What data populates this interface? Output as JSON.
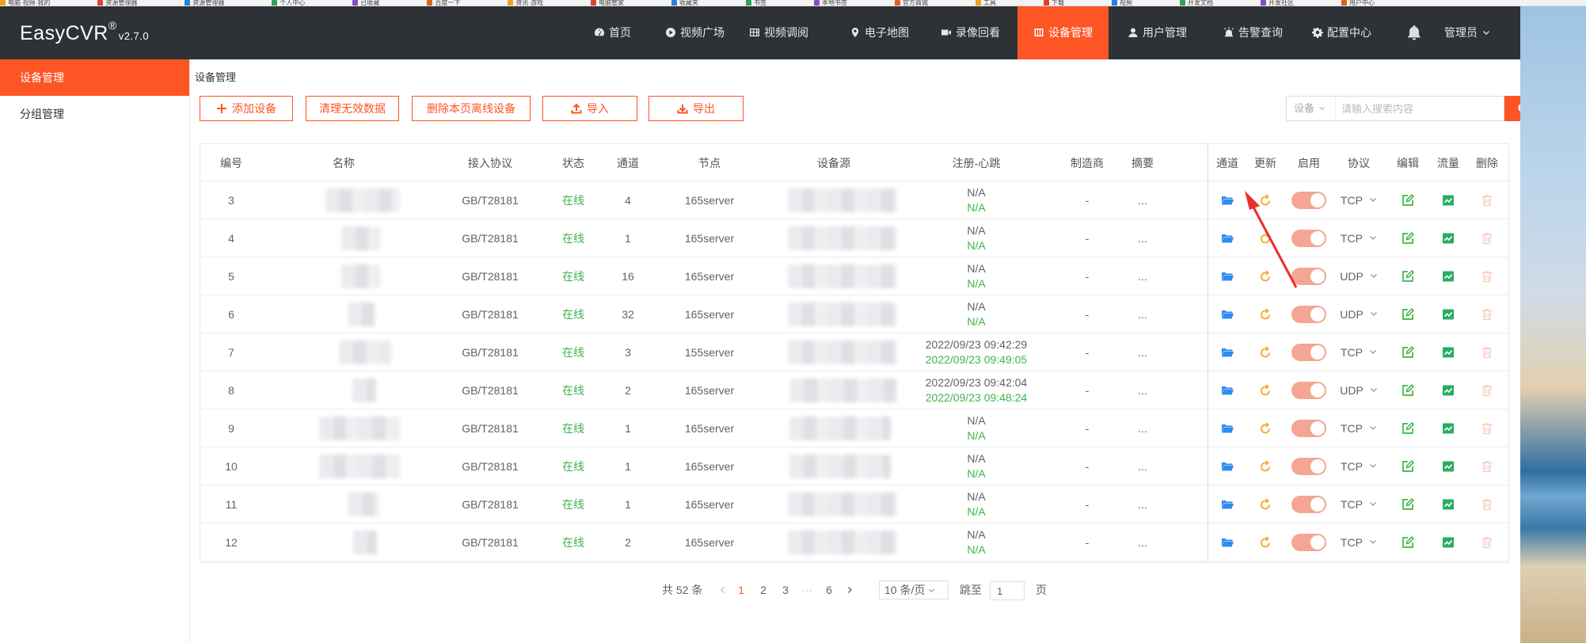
{
  "bookmarks": [
    "电脑·视频·我的",
    "资源管理器",
    "资源管理器",
    "个人中心",
    "已收藏",
    "百度一下",
    "资讯·游戏",
    "电脑管家",
    "收藏夹",
    "书签",
    "本地书签",
    "官方商城",
    "工具",
    "下载",
    "视频",
    "开发文档",
    "开发社区",
    "用户中心"
  ],
  "app": {
    "brand": "EasyCVR",
    "brand_mark": "®",
    "version": "v2.7.0"
  },
  "nav": [
    {
      "label": "首页",
      "icon": "dashboard-icon"
    },
    {
      "label": "视频广场",
      "icon": "play-circle-icon"
    },
    {
      "label": "视频调阅",
      "icon": "grid-icon"
    },
    {
      "label": "电子地图",
      "icon": "map-pin-icon"
    },
    {
      "label": "录像回看",
      "icon": "video-camera-icon"
    },
    {
      "label": "设备管理",
      "icon": "device-icon",
      "active": true
    },
    {
      "label": "用户管理",
      "icon": "user-icon"
    },
    {
      "label": "告警查询",
      "icon": "alarm-icon"
    },
    {
      "label": "配置中心",
      "icon": "gear-icon"
    }
  ],
  "user": {
    "name": "管理员"
  },
  "sidebar": [
    {
      "label": "设备管理",
      "active": true
    },
    {
      "label": "分组管理",
      "active": false
    }
  ],
  "breadcrumb": "设备管理",
  "toolbar": {
    "add": "添加设备",
    "clean": "清理无效数据",
    "delete_offline": "删除本页离线设备",
    "import": "导入",
    "export": "导出"
  },
  "search": {
    "type": "设备",
    "placeholder": "请输入搜索内容"
  },
  "table": {
    "headers": [
      "编号",
      "名称",
      "接入协议",
      "状态",
      "通道",
      "节点",
      "设备源",
      "注册-心跳",
      "制造商",
      "摘要",
      "通道",
      "更新",
      "启用",
      "协议",
      "编辑",
      "流量",
      "删除"
    ],
    "rows": [
      {
        "id": "3",
        "protocol": "GB/T28181",
        "status": "在线",
        "channels": "4",
        "node": "165server",
        "register": "N/A",
        "heartbeat": "N/A",
        "maker": "-",
        "summary": "...",
        "transport": "TCP"
      },
      {
        "id": "4",
        "protocol": "GB/T28181",
        "status": "在线",
        "channels": "1",
        "node": "165server",
        "register": "N/A",
        "heartbeat": "N/A",
        "maker": "-",
        "summary": "...",
        "transport": "TCP"
      },
      {
        "id": "5",
        "protocol": "GB/T28181",
        "status": "在线",
        "channels": "16",
        "node": "165server",
        "register": "N/A",
        "heartbeat": "N/A",
        "maker": "-",
        "summary": "...",
        "transport": "UDP"
      },
      {
        "id": "6",
        "protocol": "GB/T28181",
        "status": "在线",
        "channels": "32",
        "node": "165server",
        "register": "N/A",
        "heartbeat": "N/A",
        "maker": "-",
        "summary": "...",
        "transport": "UDP"
      },
      {
        "id": "7",
        "protocol": "GB/T28181",
        "status": "在线",
        "channels": "3",
        "node": "155server",
        "register": "2022/09/23 09:42:29",
        "heartbeat": "2022/09/23 09:49:05",
        "maker": "-",
        "summary": "...",
        "transport": "TCP"
      },
      {
        "id": "8",
        "protocol": "GB/T28181",
        "status": "在线",
        "channels": "2",
        "node": "165server",
        "register": "2022/09/23 09:42:04",
        "heartbeat": "2022/09/23 09:48:24",
        "maker": "-",
        "summary": "...",
        "transport": "UDP"
      },
      {
        "id": "9",
        "protocol": "GB/T28181",
        "status": "在线",
        "channels": "1",
        "node": "165server",
        "register": "N/A",
        "heartbeat": "N/A",
        "maker": "-",
        "summary": "...",
        "transport": "TCP"
      },
      {
        "id": "10",
        "protocol": "GB/T28181",
        "status": "在线",
        "channels": "1",
        "node": "165server",
        "register": "N/A",
        "heartbeat": "N/A",
        "maker": "-",
        "summary": "...",
        "transport": "TCP"
      },
      {
        "id": "11",
        "protocol": "GB/T28181",
        "status": "在线",
        "channels": "1",
        "node": "165server",
        "register": "N/A",
        "heartbeat": "N/A",
        "maker": "-",
        "summary": "...",
        "transport": "TCP"
      },
      {
        "id": "12",
        "protocol": "GB/T28181",
        "status": "在线",
        "channels": "2",
        "node": "165server",
        "register": "N/A",
        "heartbeat": "N/A",
        "maker": "-",
        "summary": "...",
        "transport": "TCP"
      }
    ]
  },
  "pagination": {
    "total": "共 52 条",
    "pages": [
      "1",
      "2",
      "3",
      "···",
      "6"
    ],
    "current": "1",
    "page_size": "10 条/页",
    "jump_label": "跳至",
    "jump_value": "1",
    "page_suffix": "页"
  },
  "colors": {
    "accent": "#fd5524",
    "header": "#2e3135",
    "online": "#3bb54a",
    "folder_icon": "#2d8cf0",
    "refresh_icon": "#f5a623",
    "edit_icon": "#3bb54a",
    "flow_icon": "#27ae60",
    "delete_icon": "#f8c6b8",
    "annotation_arrow": "#e8312a"
  }
}
